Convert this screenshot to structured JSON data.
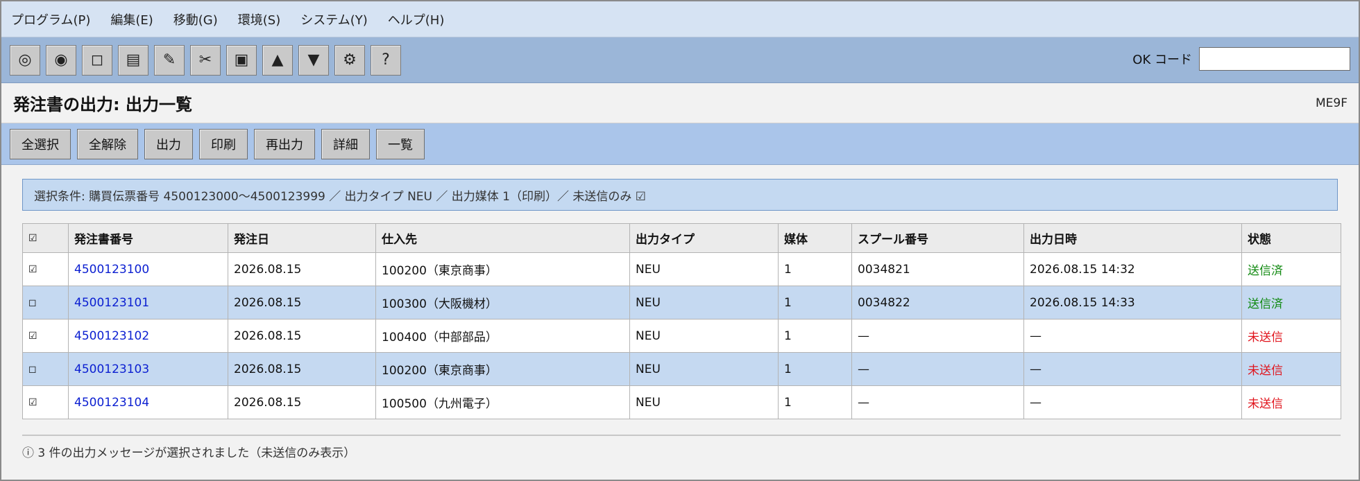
{
  "menu": [
    "プログラム(P)",
    "編集(E)",
    "移動(G)",
    "環境(S)",
    "システム(Y)",
    "ヘルプ(H)"
  ],
  "toolbar": {
    "buttons": [
      {
        "name": "enter-icon",
        "glyph": "◎"
      },
      {
        "name": "record-icon",
        "glyph": "◉"
      },
      {
        "name": "new-icon",
        "glyph": "◻"
      },
      {
        "name": "list-icon",
        "glyph": "▤"
      },
      {
        "name": "edit-icon",
        "glyph": "✎"
      },
      {
        "name": "cut-icon",
        "glyph": "✂"
      },
      {
        "name": "display-icon",
        "glyph": "▣"
      },
      {
        "name": "page-up-icon",
        "glyph": "▲"
      },
      {
        "name": "page-down-icon",
        "glyph": "▼"
      },
      {
        "name": "settings-icon",
        "glyph": "⚙"
      },
      {
        "name": "help-icon",
        "glyph": "?"
      }
    ],
    "ok_code_label": "OK コード",
    "ok_code_value": ""
  },
  "title": {
    "text": "発注書の出力: 出力一覧",
    "transaction": "ME9F"
  },
  "actions": [
    "全選択",
    "全解除",
    "出力",
    "印刷",
    "再出力",
    "詳細",
    "一覧"
  ],
  "criteria": "選択条件: 購買伝票番号 4500123000〜4500123999 ／ 出力タイプ NEU ／ 出力媒体 1（印刷）／ 未送信のみ ☑",
  "table": {
    "headers": [
      "☑",
      "発注書番号",
      "発注日",
      "仕入先",
      "出力タイプ",
      "媒体",
      "スプール番号",
      "出力日時",
      "状態"
    ],
    "rows": [
      {
        "check": "☑",
        "po": "4500123100",
        "date": "2026.08.15",
        "vendor": "100200（東京商事）",
        "type": "NEU",
        "medium": "1",
        "spool": "0034821",
        "output_at": "2026.08.15 14:32",
        "status": "送信済",
        "status_kind": "sent"
      },
      {
        "check": "◻",
        "po": "4500123101",
        "date": "2026.08.15",
        "vendor": "100300（大阪機材）",
        "type": "NEU",
        "medium": "1",
        "spool": "0034822",
        "output_at": "2026.08.15 14:33",
        "status": "送信済",
        "status_kind": "sent"
      },
      {
        "check": "☑",
        "po": "4500123102",
        "date": "2026.08.15",
        "vendor": "100400（中部部品）",
        "type": "NEU",
        "medium": "1",
        "spool": "—",
        "output_at": "—",
        "status": "未送信",
        "status_kind": "unsent"
      },
      {
        "check": "◻",
        "po": "4500123103",
        "date": "2026.08.15",
        "vendor": "100200（東京商事）",
        "type": "NEU",
        "medium": "1",
        "spool": "—",
        "output_at": "—",
        "status": "未送信",
        "status_kind": "unsent"
      },
      {
        "check": "☑",
        "po": "4500123104",
        "date": "2026.08.15",
        "vendor": "100500（九州電子）",
        "type": "NEU",
        "medium": "1",
        "spool": "—",
        "output_at": "—",
        "status": "未送信",
        "status_kind": "unsent"
      }
    ]
  },
  "status_message": "ⓘ 3 件の出力メッセージが選択されました（未送信のみ表示）",
  "colors": {
    "sent": "#118a11",
    "unsent": "#e0141c",
    "link": "#0b1fd1"
  }
}
